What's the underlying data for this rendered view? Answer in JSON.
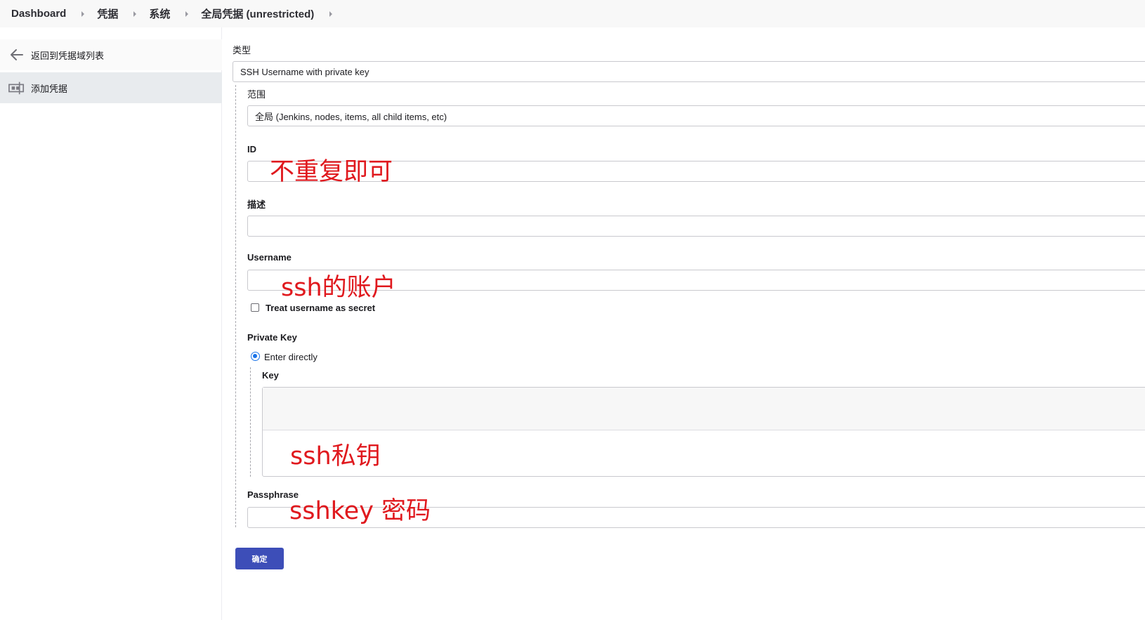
{
  "breadcrumb": [
    "Dashboard",
    "凭据",
    "系统",
    "全局凭据 (unrestricted)"
  ],
  "sidebar": {
    "back_label": "返回到凭据域列表",
    "add_label": "添加凭据"
  },
  "form": {
    "kind_label": "类型",
    "kind_value": "SSH Username with private key",
    "scope_label": "范围",
    "scope_value": "全局 (Jenkins, nodes, items, all child items, etc)",
    "id_label": "ID",
    "id_value": "",
    "description_label": "描述",
    "description_value": "",
    "username_label": "Username",
    "username_value": "",
    "username_secret_label": "Treat username as secret",
    "username_secret_checked": false,
    "private_key_label": "Private Key",
    "enter_directly_label": "Enter directly",
    "key_label": "Key",
    "key_value": "",
    "passphrase_label": "Passphrase",
    "passphrase_value": "",
    "ok_label": "确定"
  },
  "annotations": {
    "id_note": "不重复即可",
    "username_note": "ssh的账户",
    "key_note": "ssh私钥",
    "passphrase_note": "sshkey 密码",
    "color": "#e0191e"
  },
  "colors": {
    "button": "#3d4eb8",
    "radio": "#1a73e8",
    "sidebar_active": "#e8ebee"
  }
}
